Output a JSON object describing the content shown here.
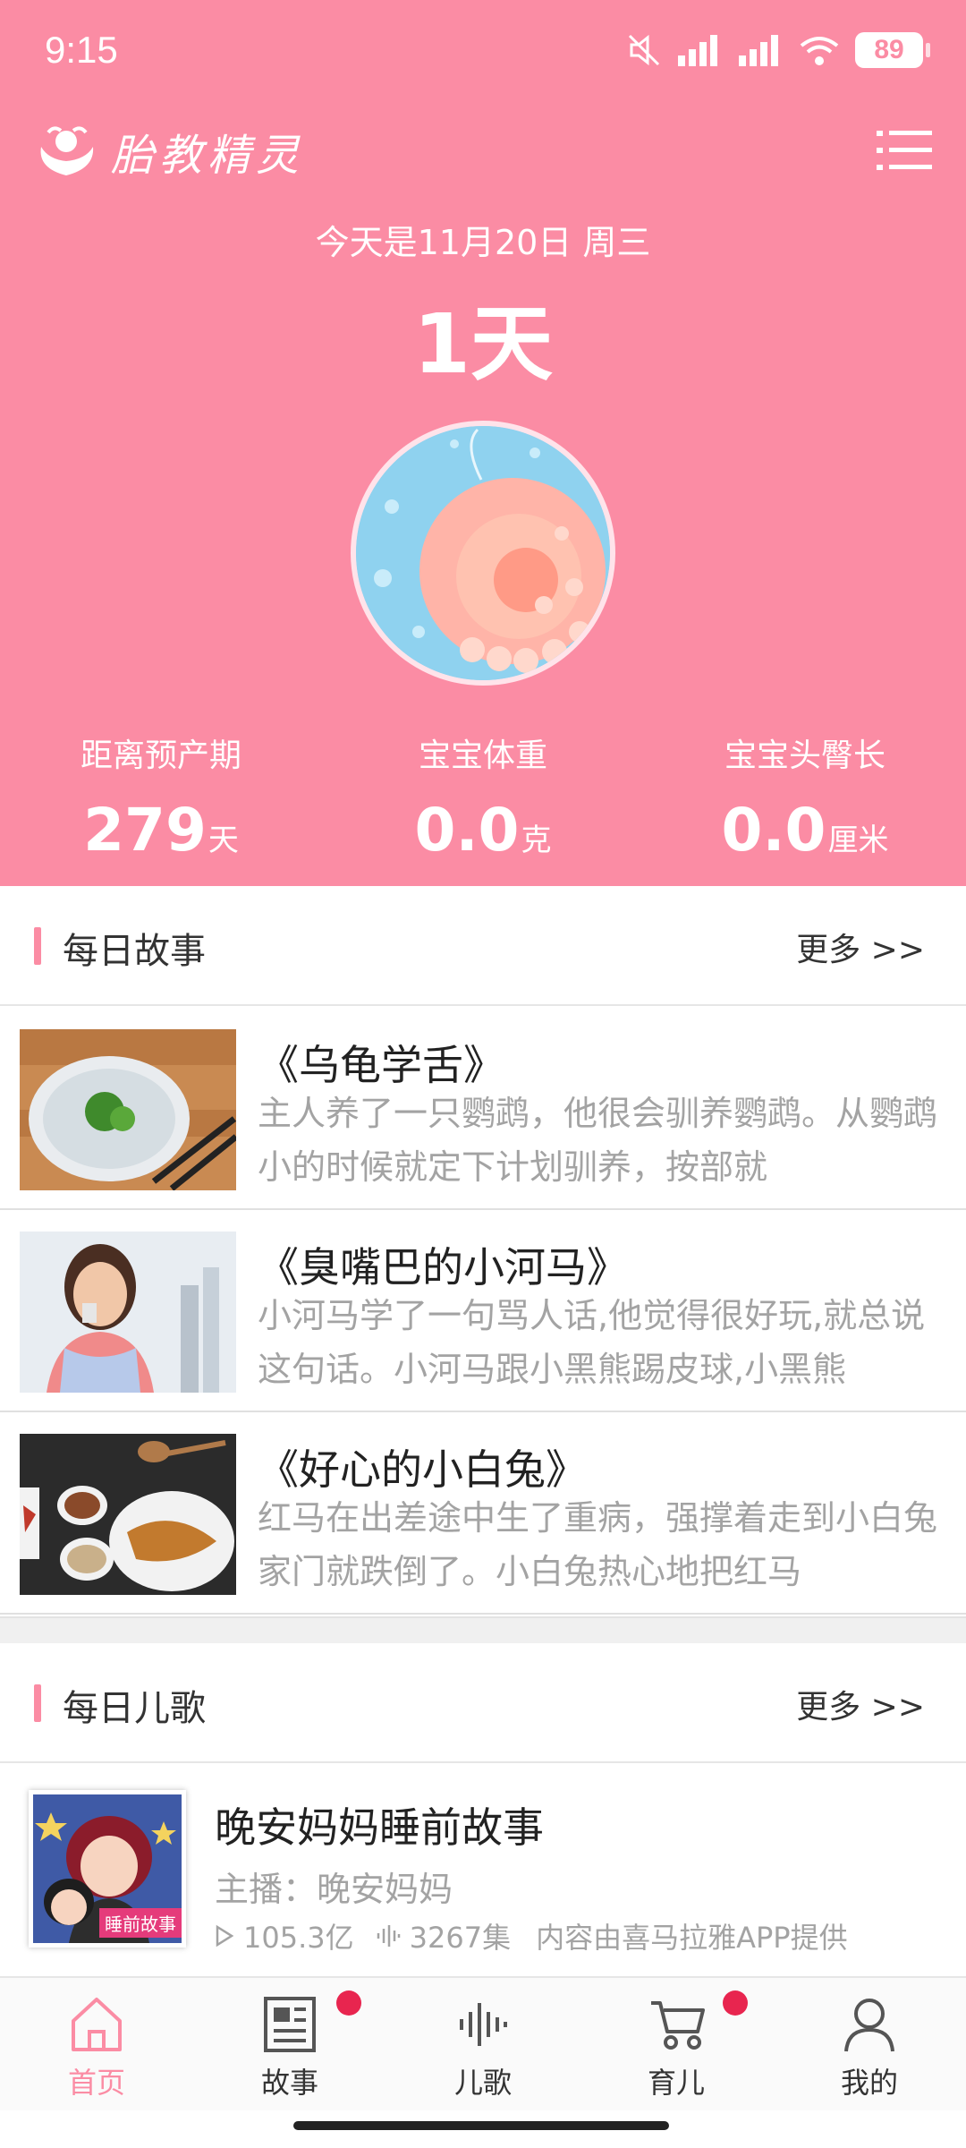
{
  "status": {
    "time": "9:15",
    "battery": "89"
  },
  "app": {
    "name": "胎教精灵"
  },
  "pregnancy": {
    "date_text": "今天是11月20日 周三",
    "days_text": "1天",
    "stats": [
      {
        "label": "距离预产期",
        "value": "279",
        "unit": "天"
      },
      {
        "label": "宝宝体重",
        "value": "0.0",
        "unit": "克"
      },
      {
        "label": "宝宝头臀长",
        "value": "0.0",
        "unit": "厘米"
      }
    ]
  },
  "daily_story": {
    "title": "每日故事",
    "more": "更多 >>",
    "items": [
      {
        "title": "《乌龟学舌》",
        "desc": "主人养了一只鹦鹉，他很会驯养鹦鹉。从鹦鹉小的时候就定下计划驯养，按部就"
      },
      {
        "title": "《臭嘴巴的小河马》",
        "desc": "小河马学了一句骂人话,他觉得很好玩,就总说这句话。小河马跟小黑熊踢皮球,小黑熊"
      },
      {
        "title": "《好心的小白兔》",
        "desc": "红马在出差途中生了重病，强撑着走到小白兔家门就跌倒了。小白兔热心地把红马"
      }
    ]
  },
  "daily_song": {
    "title": "每日儿歌",
    "more": "更多 >>",
    "item": {
      "title": "晚安妈妈睡前故事",
      "host": "主播：晚安妈妈",
      "plays": "105.3亿",
      "episodes": "3267集",
      "source": "内容由喜马拉雅APP提供",
      "cover_tag": "睡前故事"
    }
  },
  "tabs": [
    {
      "label": "首页"
    },
    {
      "label": "故事"
    },
    {
      "label": "儿歌"
    },
    {
      "label": "育儿"
    },
    {
      "label": "我的"
    }
  ],
  "colors": {
    "accent": "#fb8ca4",
    "badge": "#e8254f"
  }
}
